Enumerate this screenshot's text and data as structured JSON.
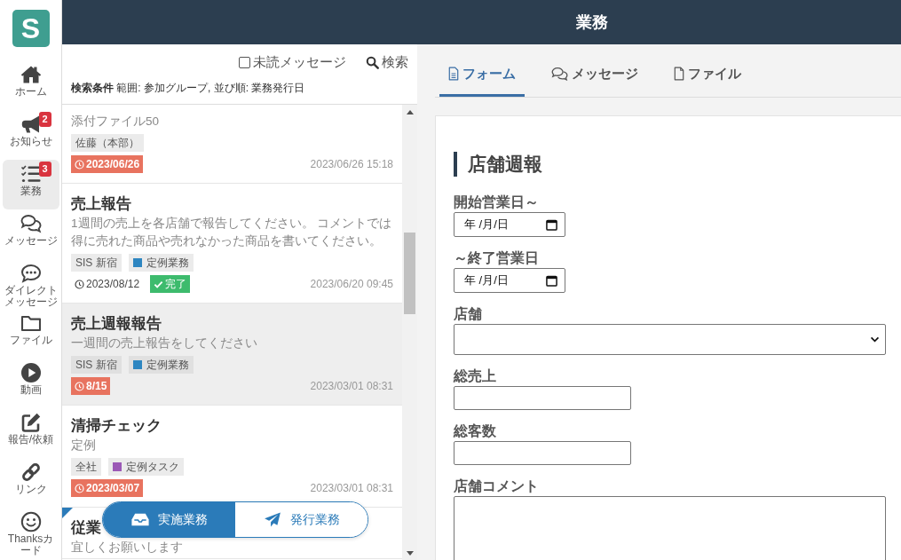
{
  "sidebar": {
    "logo": "S",
    "items": [
      {
        "label": "ホーム",
        "selected": false
      },
      {
        "label": "お知らせ",
        "badge": "2",
        "selected": false
      },
      {
        "label": "業務",
        "badge": "3",
        "selected": true
      },
      {
        "label": "メッセージ",
        "selected": false
      },
      {
        "label": "ダイレクトメッセージ",
        "selected": false
      },
      {
        "label": "ファイル",
        "selected": false
      },
      {
        "label": "動画",
        "selected": false
      },
      {
        "label": "報告/依頼",
        "selected": false
      },
      {
        "label": "リンク",
        "selected": false
      },
      {
        "label": "Thanksカード",
        "selected": false
      }
    ]
  },
  "header": {
    "title": "業務"
  },
  "list_panel": {
    "unread_filter": {
      "label": "未読メッセージ",
      "checked": false
    },
    "search_button": "検索",
    "search_conditions": "**検索条件** 範囲: 参加グループ, 並び順: 業務発行日",
    "items": [
      {
        "description": "添付ファイル50",
        "tags": [
          {
            "label": "佐藤（本部）"
          }
        ],
        "due": {
          "date": "2023/06/26",
          "overdue": true
        },
        "updated": "2023/06/26 15:18",
        "selected": false,
        "unread": false
      },
      {
        "title": "売上報告",
        "description": "1週間の売上を各店舗で報告してください。 コメントでは得に売れた商品や売れなかった商品を書いてください。",
        "tags": [
          {
            "label": "SIS 新宿"
          },
          {
            "label": "定例業務",
            "color": "#2e86c1"
          }
        ],
        "due": {
          "date": "2023/08/12",
          "overdue": false
        },
        "status": "完了",
        "updated": "2023/06/20 09:45",
        "selected": false,
        "unread": false
      },
      {
        "title": "売上週報報告",
        "description": "一週間の売上報告をしてください",
        "tags": [
          {
            "label": "SIS 新宿"
          },
          {
            "label": "定例業務",
            "color": "#2e86c1"
          }
        ],
        "due": {
          "date": "8/15",
          "overdue": true
        },
        "updated": "2023/03/01 08:31",
        "selected": true,
        "unread": false
      },
      {
        "title": "清掃チェック",
        "description": "定例",
        "tags": [
          {
            "label": "全社"
          },
          {
            "label": "定例タスク",
            "color": "#9b59b6"
          }
        ],
        "due": {
          "date": "2023/03/07",
          "overdue": true
        },
        "updated": "2023/03/01 08:31",
        "selected": false,
        "unread": false
      },
      {
        "title": "従業",
        "description": "宜しくお願いします",
        "selected": false,
        "unread": true
      }
    ]
  },
  "mode_toggle": [
    {
      "label": "実施業務",
      "selected": true
    },
    {
      "label": "発行業務",
      "selected": false
    }
  ],
  "detail": {
    "tabs": [
      {
        "label": "フォーム",
        "selected": true
      },
      {
        "label": "メッセージ",
        "selected": false
      },
      {
        "label": "ファイル",
        "selected": false
      }
    ],
    "form": {
      "title": "店舗週報",
      "fields": [
        {
          "label": "開始営業日～",
          "kind": "date",
          "placeholder": "年 /月/日"
        },
        {
          "label": "～終了営業日",
          "kind": "date",
          "placeholder": "年 /月/日"
        },
        {
          "label": "店舗",
          "kind": "select"
        },
        {
          "label": "総売上",
          "kind": "text"
        },
        {
          "label": "総客数",
          "kind": "text"
        },
        {
          "label": "店舗コメント",
          "kind": "textarea"
        }
      ]
    }
  }
}
